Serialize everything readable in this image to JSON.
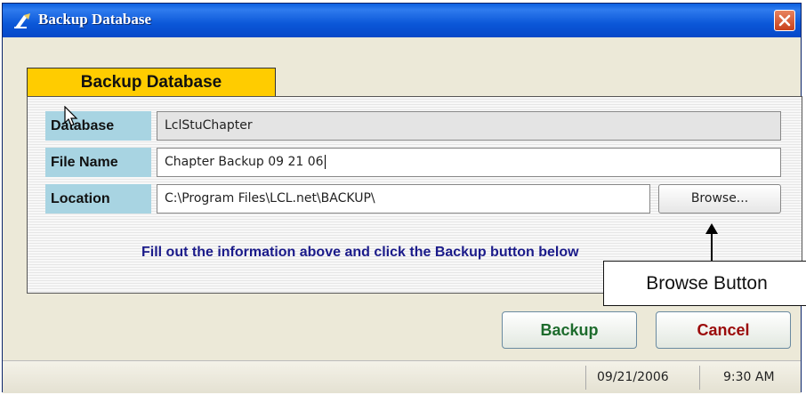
{
  "window": {
    "title": "Backup Database",
    "title_icon": "backup-app-icon"
  },
  "tab": {
    "label": "Backup Database"
  },
  "form": {
    "database": {
      "label": "Database",
      "value": "LclStuChapter"
    },
    "file_name": {
      "label": "File Name",
      "value": "Chapter Backup 09 21 06"
    },
    "location": {
      "label": "Location",
      "value": "C:\\Program Files\\LCL.net\\BACKUP\\"
    },
    "browse_label": "Browse..."
  },
  "instruction": "Fill out the information above and click the Backup button below",
  "callout": {
    "text": "Browse Button"
  },
  "buttons": {
    "backup_label": "Backup",
    "cancel_label": "Cancel"
  },
  "statusbar": {
    "date": "09/21/2006",
    "time": "9:30 AM"
  },
  "colors": {
    "tab": "#FFCC00",
    "label_bg": "#A8D4E2",
    "instruction": "#1B1B8A",
    "backup": "#1d6b2c",
    "cancel": "#9b0a0a"
  }
}
